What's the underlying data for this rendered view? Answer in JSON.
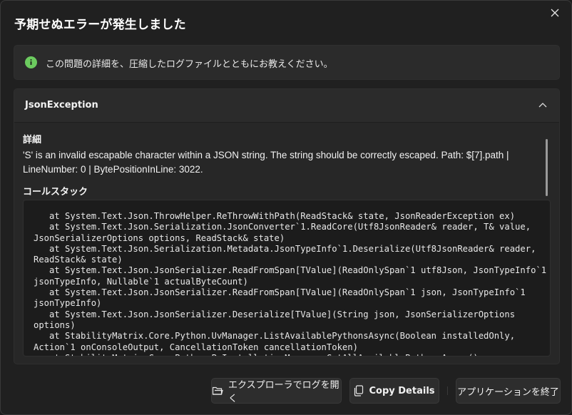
{
  "dialog": {
    "title": "予期せぬエラーが発生しました",
    "close_icon": "close-icon"
  },
  "info_bar": {
    "icon": "info-icon",
    "icon_color": "#6ccb5f",
    "message": "この問題の詳細を、圧縮したログファイルとともにお教えください。"
  },
  "exception": {
    "name": "JsonException",
    "expanded": true,
    "details_label": "詳細",
    "details_text": "'S' is an invalid escapable character within a JSON string. The string should be correctly escaped. Path: $[7].path | LineNumber: 0 | BytePositionInLine: 3022.",
    "callstack_label": "コールスタック",
    "callstack": "   at System.Text.Json.ThrowHelper.ReThrowWithPath(ReadStack& state, JsonReaderException ex)\n   at System.Text.Json.Serialization.JsonConverter`1.ReadCore(Utf8JsonReader& reader, T& value, JsonSerializerOptions options, ReadStack& state)\n   at System.Text.Json.Serialization.Metadata.JsonTypeInfo`1.Deserialize(Utf8JsonReader& reader, ReadStack& state)\n   at System.Text.Json.JsonSerializer.ReadFromSpan[TValue](ReadOnlySpan`1 utf8Json, JsonTypeInfo`1 jsonTypeInfo, Nullable`1 actualByteCount)\n   at System.Text.Json.JsonSerializer.ReadFromSpan[TValue](ReadOnlySpan`1 json, JsonTypeInfo`1 jsonTypeInfo)\n   at System.Text.Json.JsonSerializer.Deserialize[TValue](String json, JsonSerializerOptions options)\n   at StabilityMatrix.Core.Python.UvManager.ListAvailablePythonsAsync(Boolean installedOnly, Action`1 onConsoleOutput, CancellationToken cancellationToken)\n   at StabilityMatrix.Core.Python.PyInstallationManager.GetAllAvailablePythonsAsync()"
  },
  "buttons": {
    "open_explorer": "エクスプローラでログを開く",
    "copy_details": "Copy Details",
    "exit_app": "アプリケーションを終了"
  }
}
